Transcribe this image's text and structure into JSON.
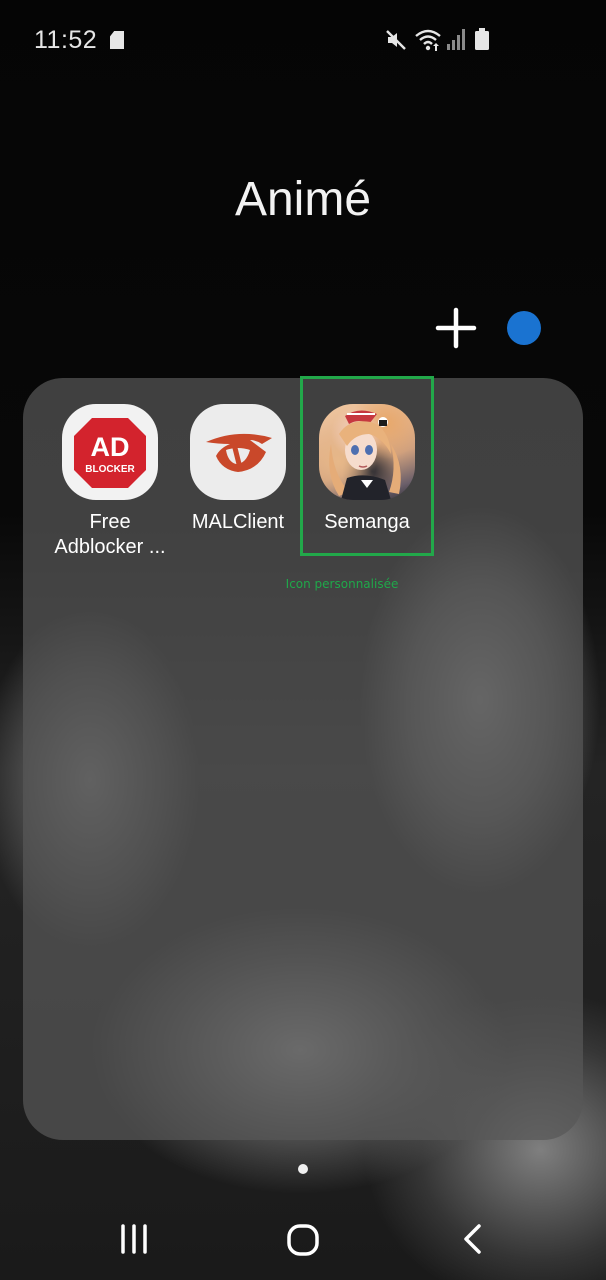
{
  "status_bar": {
    "time": "11:52",
    "icons": [
      "sd-card-icon",
      "mute-icon",
      "wifi-icon",
      "signal-icon",
      "battery-icon"
    ]
  },
  "folder": {
    "title": "Animé",
    "color": "#1a73d1",
    "apps": [
      {
        "label_line1": "Free",
        "label_line2": "Adblocker ...",
        "icon": "adblocker-icon",
        "badge_top": "AD",
        "badge_bottom": "BLOCKER"
      },
      {
        "label_line1": "MALClient",
        "label_line2": "",
        "icon": "malclient-icon"
      },
      {
        "label_line1": "Semanga",
        "label_line2": "",
        "icon": "semanga-icon"
      }
    ]
  },
  "annotation": {
    "text": "Icon personnalisée",
    "color": "#22a84a"
  },
  "pager": {
    "pages": 1,
    "current": 1
  },
  "nav_bar": {
    "icons": [
      "recents-icon",
      "home-icon",
      "back-icon"
    ]
  }
}
